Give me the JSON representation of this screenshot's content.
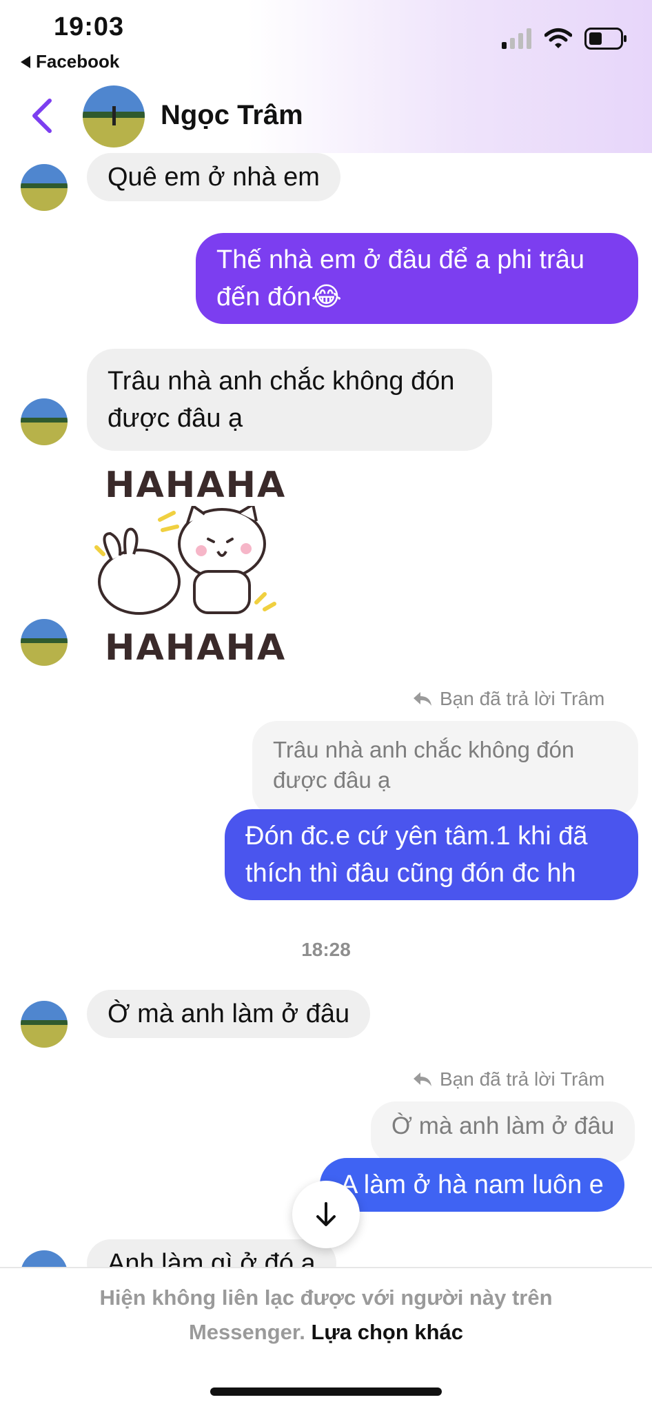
{
  "status_bar": {
    "time": "19:03",
    "back_app": "Facebook"
  },
  "header": {
    "contact_name": "Ngọc Trâm"
  },
  "messages": [
    {
      "text": "Quê em ở nhà em"
    },
    {
      "text": "Thế nhà em ở đâu để a phi trâu đến đón😂"
    },
    {
      "text": "Trâu nhà anh chắc không đón được đâu ạ"
    },
    {
      "sticker_text_top": "HAHAHA",
      "sticker_text_bottom": "HAHAHA"
    },
    {
      "reply_label": "Bạn đã trả lời Trâm",
      "quote": "Trâu nhà anh chắc không đón được đâu ạ",
      "text": "Đón đc.e cứ yên tâm.1 khi đã thích thì đâu cũng đón đc hh"
    },
    {
      "timestamp": "18:28"
    },
    {
      "text": "Ờ mà anh làm ở đâu"
    },
    {
      "reply_label": "Bạn đã trả lời Trâm",
      "quote": "Ờ mà anh làm ở đâu",
      "text": "A làm ở hà nam luôn e"
    },
    {
      "text": "Anh làm gì ở đó a"
    }
  ],
  "footer": {
    "notice": "Hiện không liên lạc được với người này trên",
    "notice_2": "Messenger.",
    "link": "Lựa chọn khác"
  },
  "colors": {
    "accent": "#7c3ef0",
    "outgoing_purple": "#7c3ef0",
    "outgoing_blue": "#4a55ee",
    "incoming": "#efefef"
  },
  "icons": [
    "back-chevron-icon",
    "signal-icon",
    "wifi-icon",
    "battery-icon",
    "reply-arrow-icon",
    "arrow-down-icon"
  ]
}
